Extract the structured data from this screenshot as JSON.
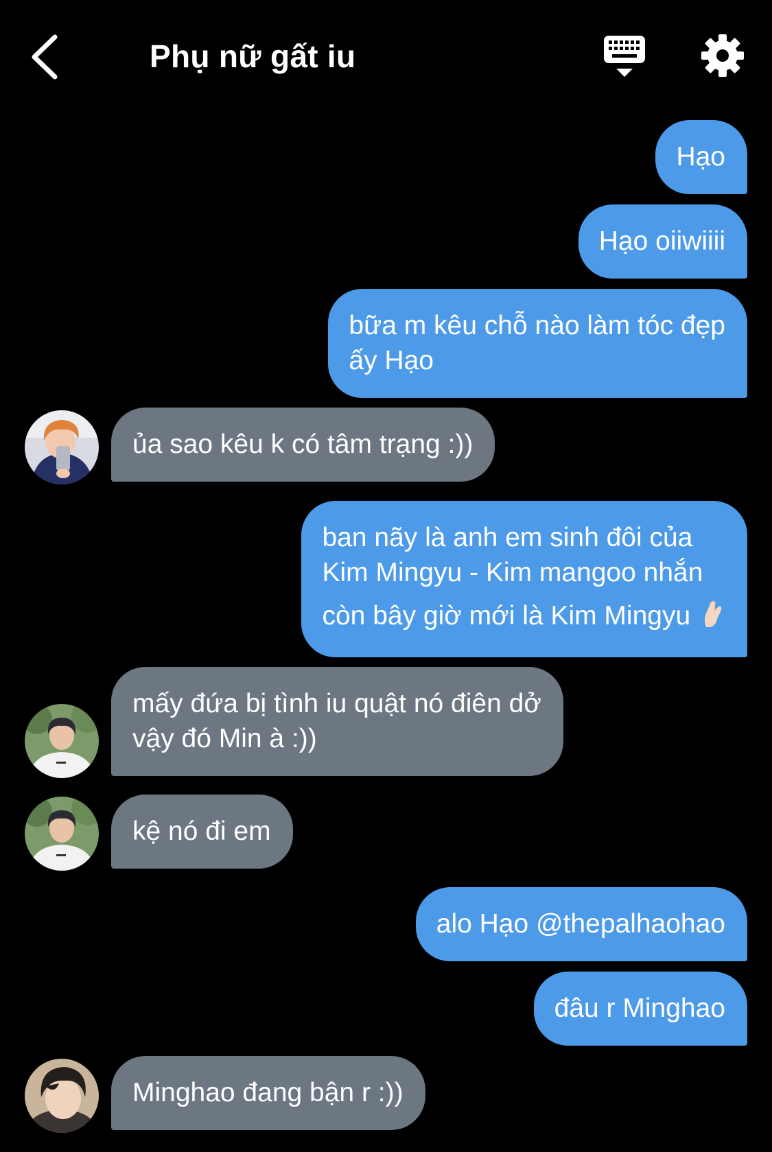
{
  "header": {
    "title": "Phụ nữ gất iu",
    "back_icon": "chevron-left-icon",
    "keyboard_icon": "keyboard-dismiss-icon",
    "settings_icon": "gear-icon"
  },
  "colors": {
    "background": "#000000",
    "outgoing_bubble": "#4d9be8",
    "incoming_bubble": "#6c7782",
    "text": "#ffffff"
  },
  "messages": [
    {
      "direction": "outgoing",
      "lines": [
        "Hạo"
      ]
    },
    {
      "direction": "outgoing",
      "lines": [
        "Hạo oiiwiiii"
      ]
    },
    {
      "direction": "outgoing",
      "lines": [
        "bữa m kêu chỗ nào làm tóc đẹp",
        "ấy Hạo"
      ]
    },
    {
      "direction": "incoming",
      "avatar": "orange-hair-selfie-avatar",
      "lines": [
        "ủa sao kêu k có tâm trạng :))"
      ]
    },
    {
      "direction": "outgoing",
      "lines": [
        "ban nãy là anh em sinh đôi của",
        "Kim Mingyu - Kim mangoo nhắn",
        "còn bây giờ mới là Kim Mingyu"
      ],
      "emoji": "🫰🏻"
    },
    {
      "direction": "incoming",
      "avatar": "white-shirt-avatar",
      "lines": [
        "mấy đứa bị tình iu quật nó điên dở",
        "vậy đó Min à :))"
      ]
    },
    {
      "direction": "incoming",
      "avatar": "white-shirt-avatar",
      "lines": [
        "kệ nó đi em"
      ]
    },
    {
      "direction": "outgoing",
      "lines": [
        "alo Hạo @thepalhaohao"
      ]
    },
    {
      "direction": "outgoing",
      "lines": [
        "đâu r Minghao"
      ]
    },
    {
      "direction": "incoming",
      "avatar": "dark-hair-avatar",
      "lines": [
        "Minghao đang bận r :))"
      ]
    }
  ]
}
